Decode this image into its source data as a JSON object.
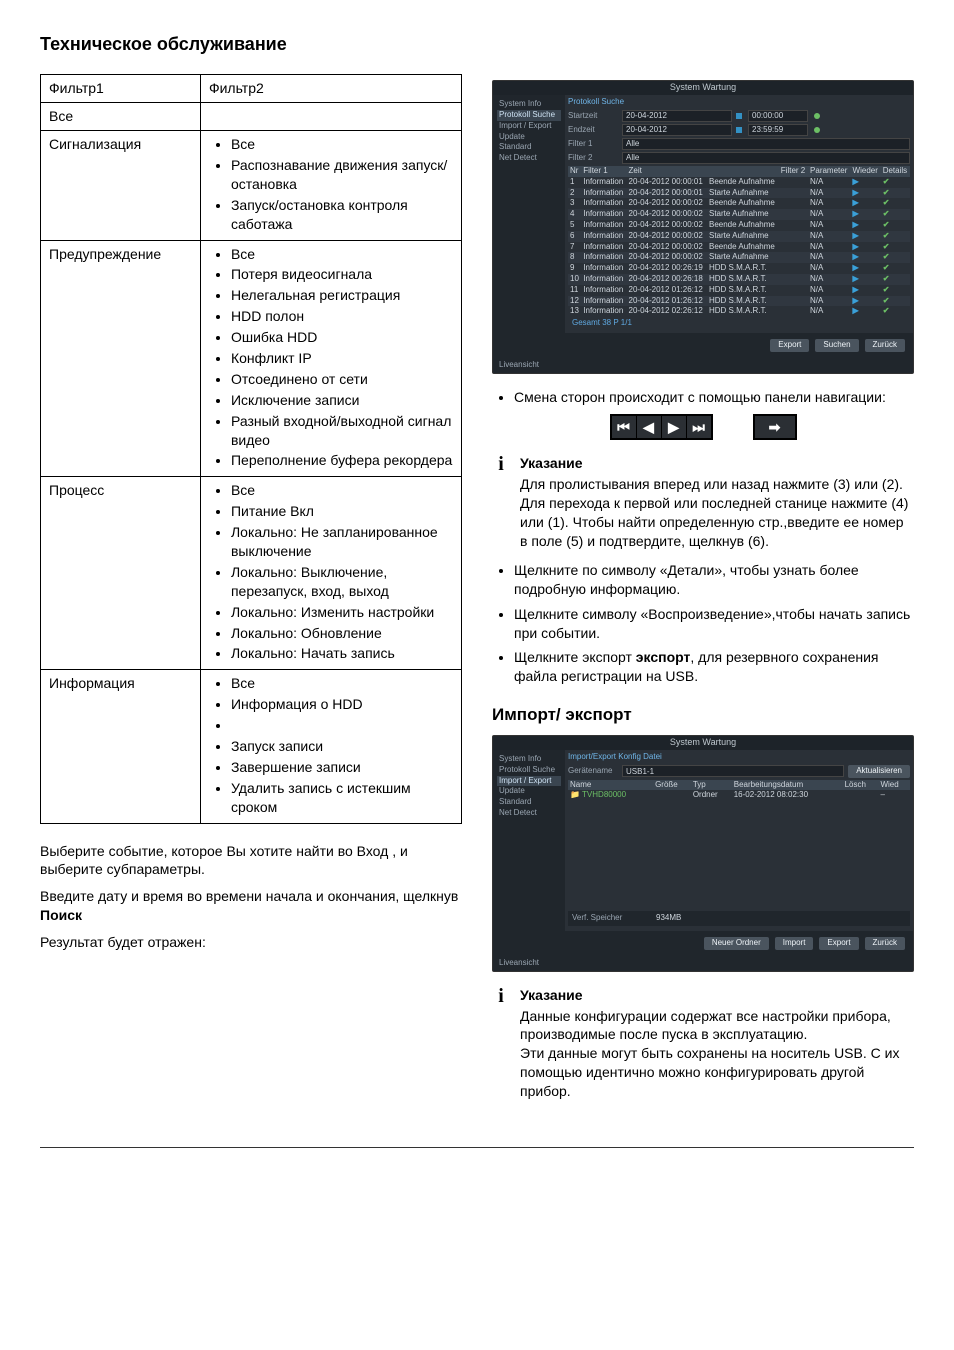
{
  "page_title": "Техническое обслуживание",
  "filter_table": {
    "headers": [
      "Фильтр1",
      "Фильтр2"
    ],
    "all_label": "Все",
    "rows": [
      {
        "filter1": "Сигнализация",
        "filter2_items": [
          "Все",
          "Распознавание движения запуск/остановка",
          "Запуск/остановка контроля саботажа"
        ]
      },
      {
        "filter1": "Предупреждение",
        "filter2_items": [
          "Все",
          "Потеря видеосигнала",
          "Нелегальная регистрация",
          "HDD полон",
          "Ошибка HDD",
          "Конфликт IP",
          "Отсоединено от сети",
          "Исключение записи",
          "Разный входной/выходной сигнал видео",
          "Переполнение буфера рекордера"
        ]
      },
      {
        "filter1": "Процесс",
        "filter2_items": [
          "Все",
          "Питание Вкл",
          "Локально: Не запланированное выключение",
          "Локально: Выключение, перезапуск, вход, выход",
          "Локально: Изменить настройки",
          "Локально: Обновление",
          "Локально: Начать запись"
        ]
      },
      {
        "filter1": "Информация",
        "filter2_items": [
          "Все",
          "Информация о HDD",
          "",
          "Запуск записи",
          "Завершение записи",
          "Удалить запись с истекшим сроком"
        ]
      }
    ]
  },
  "left_para1": "Выберите событие, которое Вы хотите найти во Вход , и выберите субпараметры.",
  "left_para2_a": "Введите дату и время во времени начала и окончания, щелкнув ",
  "left_para2_b": "Поиск",
  "left_para3": "Результат будет отражен:",
  "screenshot1": {
    "title": "System Wartung",
    "side_items": [
      "System Info",
      "Protokoll Suche",
      "Import / Export",
      "Update",
      "Standard",
      "Net Detect"
    ],
    "active_index": 1,
    "tab_active": "Protokoll Suche",
    "form": {
      "start_label": "Startzeit",
      "start_date": "20-04-2012",
      "start_time": "00:00:00",
      "end_label": "Endzeit",
      "end_date": "20-04-2012",
      "end_time": "23:59:59",
      "filter1_label": "Filter 1",
      "filter1_value": "Alle",
      "filter2_label": "Filter 2",
      "filter2_value": "Alle"
    },
    "log_header": [
      "Nr",
      "Filter 1",
      "Zeit",
      "",
      "Filter 2",
      "Parameter",
      "Wieder",
      "Details"
    ],
    "log_rows": [
      {
        "n": "1",
        "f1": "Information",
        "t": "20-04-2012 00:00:01",
        "ev": "Beende Aufnahme",
        "p": "N/A"
      },
      {
        "n": "2",
        "f1": "Information",
        "t": "20-04-2012 00:00:01",
        "ev": "Starte Aufnahme",
        "p": "N/A"
      },
      {
        "n": "3",
        "f1": "Information",
        "t": "20-04-2012 00:00:02",
        "ev": "Beende Aufnahme",
        "p": "N/A"
      },
      {
        "n": "4",
        "f1": "Information",
        "t": "20-04-2012 00:00:02",
        "ev": "Starte Aufnahme",
        "p": "N/A"
      },
      {
        "n": "5",
        "f1": "Information",
        "t": "20-04-2012 00:00:02",
        "ev": "Beende Aufnahme",
        "p": "N/A"
      },
      {
        "n": "6",
        "f1": "Information",
        "t": "20-04-2012 00:00:02",
        "ev": "Starte Aufnahme",
        "p": "N/A"
      },
      {
        "n": "7",
        "f1": "Information",
        "t": "20-04-2012 00:00:02",
        "ev": "Beende Aufnahme",
        "p": "N/A"
      },
      {
        "n": "8",
        "f1": "Information",
        "t": "20-04-2012 00:00:02",
        "ev": "Starte Aufnahme",
        "p": "N/A"
      },
      {
        "n": "9",
        "f1": "Information",
        "t": "20-04-2012 00:26:19",
        "ev": "HDD S.M.A.R.T.",
        "p": "N/A"
      },
      {
        "n": "10",
        "f1": "Information",
        "t": "20-04-2012 00:26:18",
        "ev": "HDD S.M.A.R.T.",
        "p": "N/A"
      },
      {
        "n": "11",
        "f1": "Information",
        "t": "20-04-2012 01:26:12",
        "ev": "HDD S.M.A.R.T.",
        "p": "N/A"
      },
      {
        "n": "12",
        "f1": "Information",
        "t": "20-04-2012 01:26:12",
        "ev": "HDD S.M.A.R.T.",
        "p": "N/A"
      },
      {
        "n": "13",
        "f1": "Information",
        "t": "20-04-2012 02:26:12",
        "ev": "HDD S.M.A.R.T.",
        "p": "N/A"
      }
    ],
    "footer_text": "Gesamt 38 P 1/1",
    "buttons": [
      "Export",
      "Suchen",
      "Zurück"
    ],
    "liveview": "Liveansicht"
  },
  "right_bullet1": "Смена сторон происходит с помощью панели навигации:",
  "nav_glyphs": [
    "⏮",
    "◀",
    "▶",
    "⏭"
  ],
  "nav_go": "➡",
  "note1_title": "Указание",
  "note1_body": "Для пролистывания вперед или назад нажмите (3) или (2). Для перехода к первой или последней станице нажмите (4) или (1). Чтобы найти определенную стр.,введите ее номер в поле (5) и подтвердите, щелкнув (6).",
  "bullet_details": "Щелкните по символу «Детали», чтобы узнать более подробную информацию.",
  "bullet_play": "Щелкните символу «Воспроизведение»,чтобы начать запись при событии.",
  "bullet_export_a": "Щелкните экспорт ",
  "bullet_export_b": "экспорт",
  "bullet_export_c": ", для резервного сохранения файла регистрации на USB.",
  "section2_title": "Импорт/ экспорт",
  "screenshot2": {
    "title": "System Wartung",
    "side_items": [
      "System Info",
      "Protokoll Suche",
      "Import / Export",
      "Update",
      "Standard",
      "Net Detect"
    ],
    "active_index": 2,
    "tab_active": "Import/Export Konfig Datei",
    "device_label": "Gerätename",
    "device_value": "USB1-1",
    "refresh": "Aktualisieren",
    "table_header": [
      "Name",
      "Größe",
      "Typ",
      "Bearbeitungsdatum",
      "Lösch",
      "Wied"
    ],
    "table_row": {
      "name": "TVHD80000",
      "size": "",
      "type": "Ordner",
      "date": "16-02-2012 08:02:30"
    },
    "free_label": "Verf. Speicher",
    "free_value": "934MB",
    "buttons": [
      "Neuer Ordner",
      "Import",
      "Export",
      "Zurück"
    ],
    "liveview": "Liveansicht"
  },
  "note2_title": "Указание",
  "note2_body_a": "Данные конфигурации содержат все настройки прибора, производимые после пуска в эксплуатацию.",
  "note2_body_b": "Эти данные могут быть сохранены на носитель USB. С их помощью идентично можно конфигурировать другой прибор."
}
